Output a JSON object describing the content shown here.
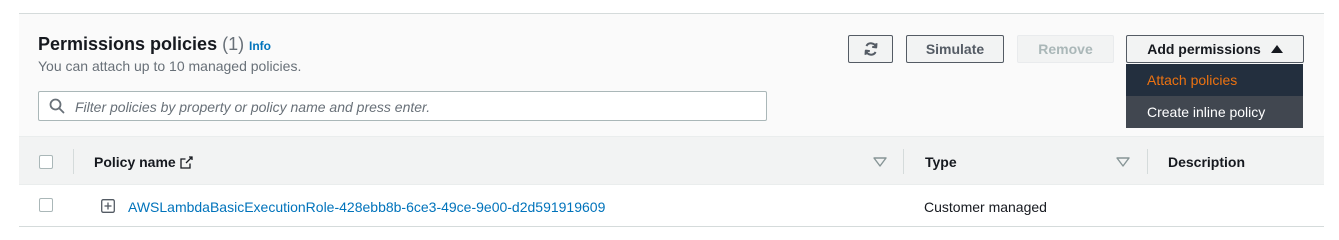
{
  "header": {
    "title": "Permissions policies",
    "count": "(1)",
    "info": "Info",
    "subtitle": "You can attach up to 10 managed policies."
  },
  "filter": {
    "placeholder": "Filter policies by property or policy name and press enter.",
    "value": ""
  },
  "toolbar": {
    "refresh_icon": "refresh-icon",
    "simulate_label": "Simulate",
    "remove_label": "Remove",
    "add_permissions_label": "Add permissions"
  },
  "dropdown": {
    "items": [
      {
        "label": "Attach policies"
      },
      {
        "label": "Create inline policy"
      }
    ]
  },
  "table": {
    "columns": [
      {
        "label": "Policy name"
      },
      {
        "label": "Type"
      },
      {
        "label": "Description"
      }
    ],
    "rows": [
      {
        "policy_name": "AWSLambdaBasicExecutionRole-428ebb8b-6ce3-49ce-9e00-d2d591919609",
        "type": "Customer managed",
        "description": ""
      }
    ]
  },
  "colors": {
    "link": "#0073bb",
    "accent_orange": "#ec7211",
    "dropdown_bg": "#232f3e"
  }
}
